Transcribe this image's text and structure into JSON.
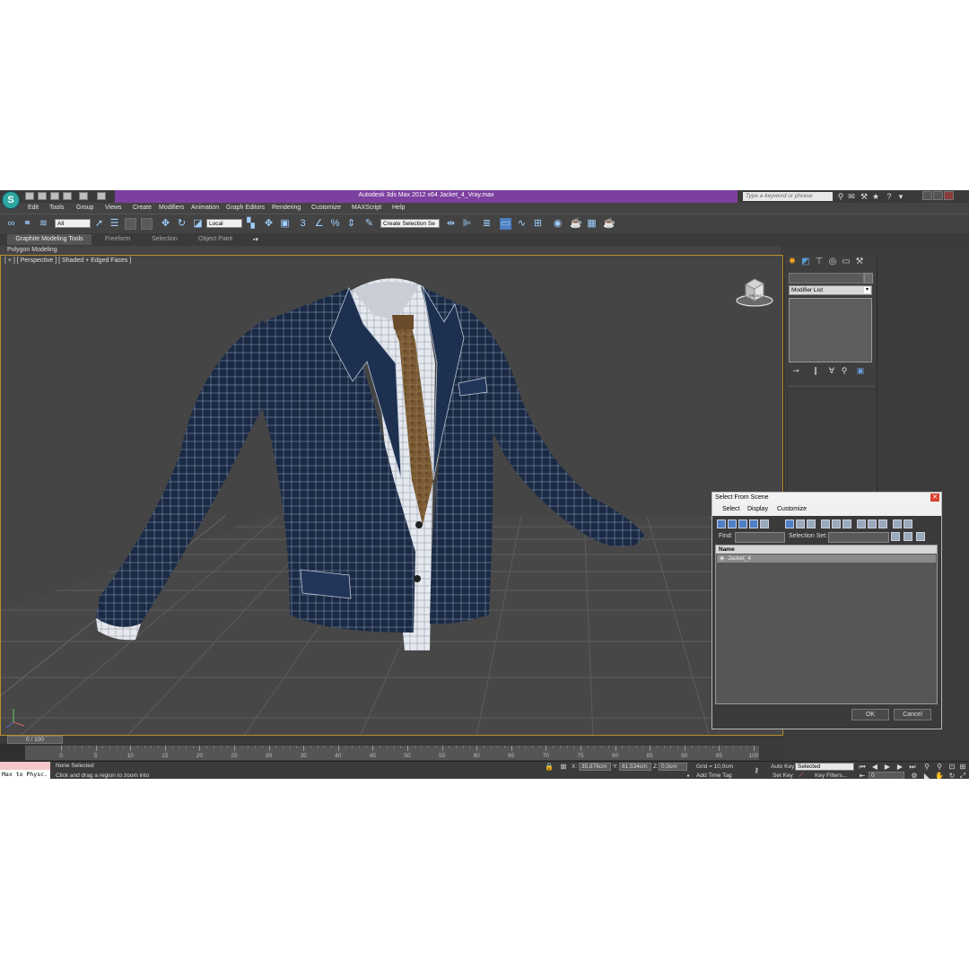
{
  "titlebar": {
    "title": "Autodesk 3ds Max  2012 x64     Jacket_4_Vray.max",
    "search_placeholder": "Type a keyword or phrase",
    "logo": "3ds-max-logo"
  },
  "menu": [
    "Edit",
    "Tools",
    "Group",
    "Views",
    "Create",
    "Modifiers",
    "Animation",
    "Graph Editors",
    "Rendering",
    "Customize",
    "MAXScript",
    "Help"
  ],
  "toolbar": {
    "filter_value": "All",
    "coord_value": "Local",
    "selection_set_placeholder": "Create Selection Se"
  },
  "ribbon": {
    "tabs": [
      "Graphite Modeling Tools",
      "Freeform",
      "Selection",
      "Object Paint"
    ],
    "panel": "Polygon Modeling"
  },
  "viewport": {
    "label": "[ + ] [ Perspective ] [ Shaded + Edged Faces ]",
    "viewcube_label": "FRONT"
  },
  "command_panel": {
    "modifier_list": "Modifier List"
  },
  "dialog": {
    "title": "Select From Scene",
    "menu": [
      "Select",
      "Display",
      "Customize"
    ],
    "find_label": "Find:",
    "selection_set_label": "Selection Set:",
    "column_name": "Name",
    "items": [
      "Jacket_4"
    ],
    "ok": "OK",
    "cancel": "Cancel"
  },
  "timeline": {
    "frame_display": "0 / 100",
    "ticks": [
      0,
      5,
      10,
      15,
      20,
      25,
      30,
      35,
      40,
      45,
      50,
      55,
      60,
      65,
      70,
      75,
      80,
      85,
      90,
      95,
      100
    ]
  },
  "status": {
    "maxscript": "Max to Physc.",
    "selection": "None Selected",
    "prompt": "Click and drag a region to zoom into",
    "x_label": "X:",
    "x_value": "35,876cm",
    "y_label": "Y:",
    "y_value": "61,534cm",
    "z_label": "Z:",
    "z_value": "0,0cm",
    "grid": "Grid = 10,0cm",
    "add_time_tag": "Add Time Tag",
    "auto_key": "Auto Key",
    "set_key": "Set Key",
    "selected_value": "Selected",
    "key_filters": "Key Filters...",
    "frame_value": "0"
  },
  "colors": {
    "title_purple": "#7d3fa0",
    "viewport_border": "#b8902a",
    "jacket": "#1b2a44",
    "shirt": "#e4e8ef",
    "tie": "#7a5a32"
  }
}
